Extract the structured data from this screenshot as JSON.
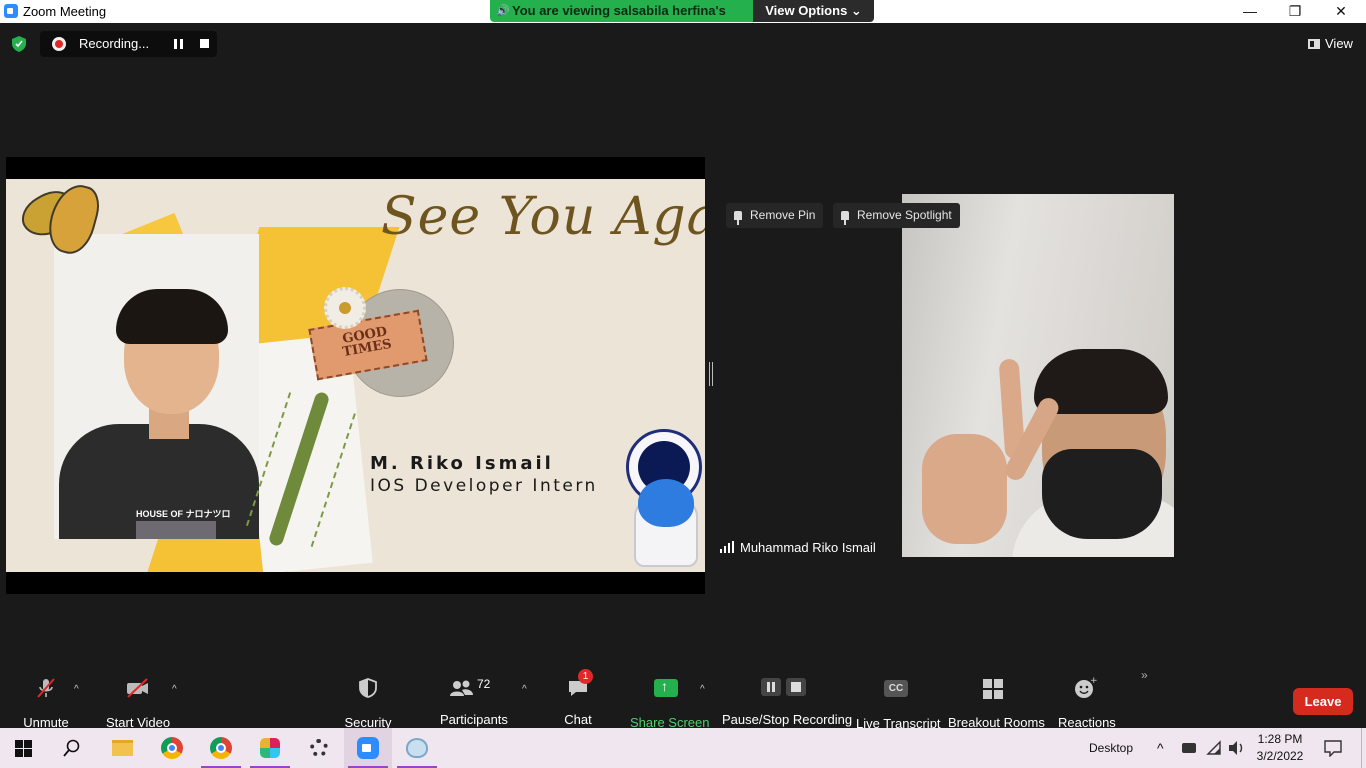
{
  "window": {
    "title": "Zoom Meeting",
    "minimize": "—",
    "restore": "❐",
    "close": "✕"
  },
  "banner": {
    "viewing_text": "You are viewing salsabila herfina's screen",
    "view_options_label": "View Options ⌄"
  },
  "recording": {
    "label": "Recording..."
  },
  "view_button": {
    "label": "View"
  },
  "slide": {
    "headline": "See You Again!",
    "ticket_text": "GOOD TIMES",
    "shirt_text": "HOUSE OF ナロナツロ",
    "name": "M. Riko Ismail",
    "role": "IOS Developer Intern"
  },
  "participant_tile": {
    "remove_pin": "Remove Pin",
    "remove_spotlight": "Remove Spotlight",
    "name": "Muhammad Riko Ismail"
  },
  "toolbar": {
    "unmute": "Unmute",
    "start_video": "Start Video",
    "security": "Security",
    "participants": "Participants",
    "participants_count": "72",
    "chat": "Chat",
    "chat_badge": "1",
    "share_screen": "Share Screen",
    "pause_stop_recording": "Pause/Stop Recording",
    "live_transcript": "Live Transcript",
    "cc_label": "CC",
    "breakout_rooms": "Breakout Rooms",
    "reactions": "Reactions",
    "more": "»",
    "leave": "Leave"
  },
  "taskbar": {
    "desktop_label": "Desktop",
    "time": "1:28 PM",
    "date": "3/2/2022"
  },
  "colors": {
    "banner_green": "#23b04d",
    "leave_red": "#d52b1e",
    "taskbar_bg": "#f0e6f0",
    "zoom_blue": "#2d8cff"
  }
}
